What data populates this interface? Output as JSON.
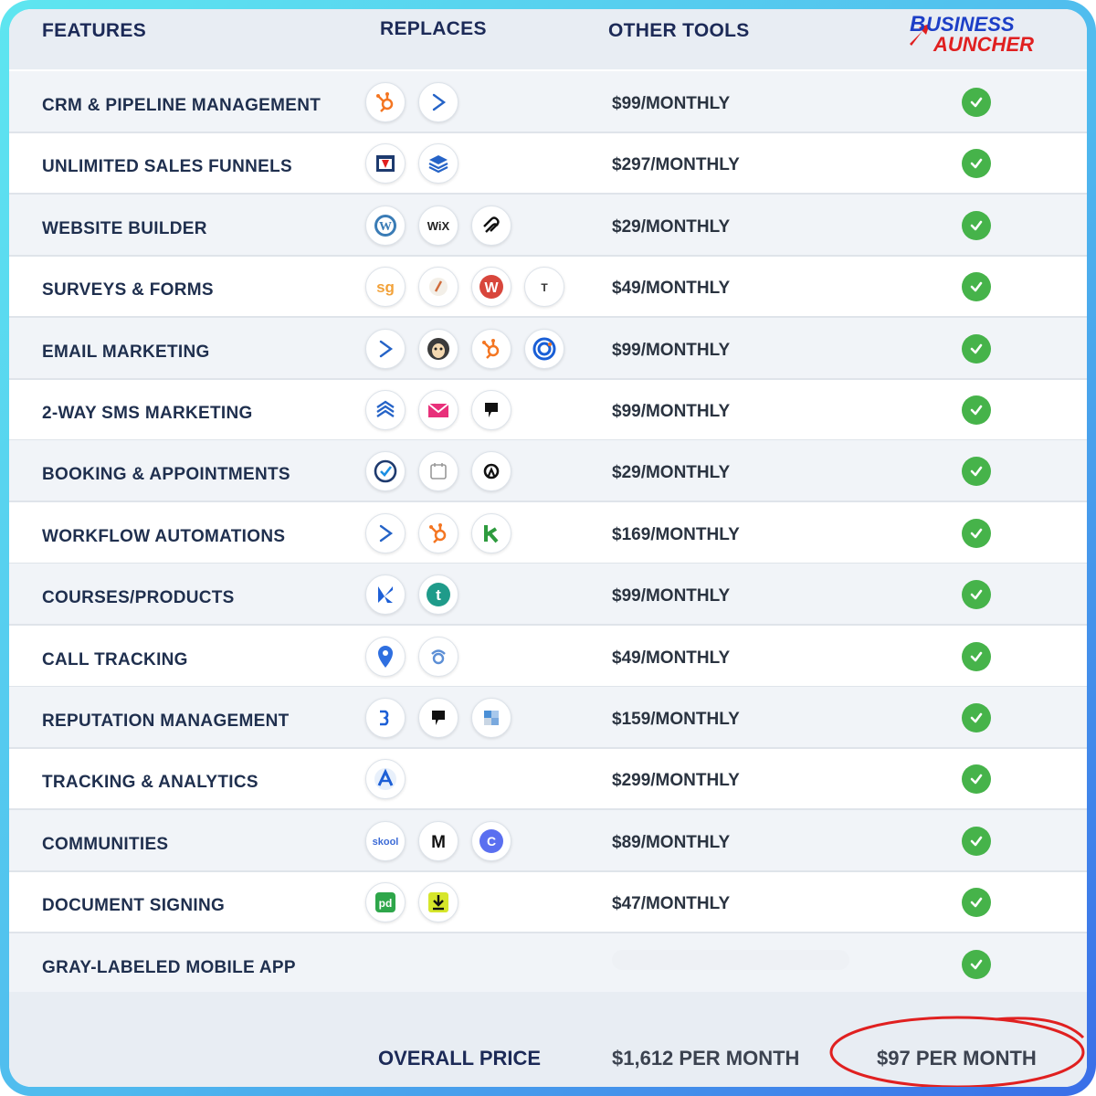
{
  "header": {
    "features": "FEATURES",
    "replaces": "REPLACES",
    "other_tools": "OTHER TOOLS",
    "logo_line1": "USINESS",
    "logo_line2": "AUNCHER",
    "logo_letter": "B"
  },
  "rows": [
    {
      "feature": "CRM & PIPELINE MANAGEMENT",
      "price": "$99/MONTHLY",
      "icons": [
        "hubspot-icon",
        "activecampaign-icon"
      ]
    },
    {
      "feature": "UNLIMITED SALES FUNNELS",
      "price": "$297/MONTHLY",
      "icons": [
        "clickfunnels-icon",
        "leadpages-icon"
      ]
    },
    {
      "feature": "WEBSITE BUILDER",
      "price": "$29/MONTHLY",
      "icons": [
        "wordpress-icon",
        "wix-icon",
        "squarespace-icon"
      ]
    },
    {
      "feature": "SURVEYS & FORMS",
      "price": "$49/MONTHLY",
      "icons": [
        "surveygizmo-icon",
        "pen-icon",
        "wufoo-icon",
        "typeform-icon"
      ]
    },
    {
      "feature": "EMAIL MARKETING",
      "price": "$99/MONTHLY",
      "icons": [
        "activecampaign-icon",
        "mailchimp-icon",
        "hubspot-icon",
        "constant-contact-icon"
      ]
    },
    {
      "feature": "2-WAY SMS MARKETING",
      "price": "$99/MONTHLY",
      "icons": [
        "waves-icon",
        "envelope-icon",
        "flag-icon"
      ]
    },
    {
      "feature": "BOOKING & APPOINTMENTS",
      "price": "$29/MONTHLY",
      "icons": [
        "calendly-icon",
        "calendar-icon",
        "acuity-icon"
      ]
    },
    {
      "feature": "WORKFLOW AUTOMATIONS",
      "price": "$169/MONTHLY",
      "icons": [
        "activecampaign-icon",
        "hubspot-icon",
        "keap-icon"
      ]
    },
    {
      "feature": "COURSES/PRODUCTS",
      "price": "$99/MONTHLY",
      "icons": [
        "kajabi-icon",
        "teachable-icon"
      ]
    },
    {
      "feature": "CALL TRACKING",
      "price": "$49/MONTHLY",
      "icons": [
        "pin-icon",
        "callrail-icon"
      ]
    },
    {
      "feature": "REPUTATION MANAGEMENT",
      "price": "$159/MONTHLY",
      "icons": [
        "birdeye-icon",
        "flag-icon",
        "puzzle-icon"
      ]
    },
    {
      "feature": "TRACKING & ANALYTICS",
      "price": "$299/MONTHLY",
      "icons": [
        "analytics-icon"
      ]
    },
    {
      "feature": "COMMUNITIES",
      "price": "$89/MONTHLY",
      "icons": [
        "skool-icon",
        "mighty-icon",
        "circle-icon"
      ]
    },
    {
      "feature": "DOCUMENT SIGNING",
      "price": "$47/MONTHLY",
      "icons": [
        "pandadoc-icon",
        "docusign-icon"
      ]
    },
    {
      "feature": "GRAY-LABELED MOBILE APP",
      "price": "",
      "icons": []
    }
  ],
  "icon_text": {
    "wix": "WiX",
    "sg": "sg",
    "typeform": "T",
    "teachable": "t",
    "skool": "skool",
    "mighty": "M",
    "circle": "C",
    "pandadoc": "pd",
    "wordpress": "W",
    "wufoo": "W"
  },
  "footer": {
    "overall": "OVERALL PRICE",
    "other_total": "$1,612 PER MONTH",
    "our_total": "$97 PER MONTH"
  },
  "colors": {
    "navy": "#1c2a57",
    "check_green": "#46b34a",
    "ring_red": "#e02020",
    "brand_blue": "#1d3fc7"
  }
}
